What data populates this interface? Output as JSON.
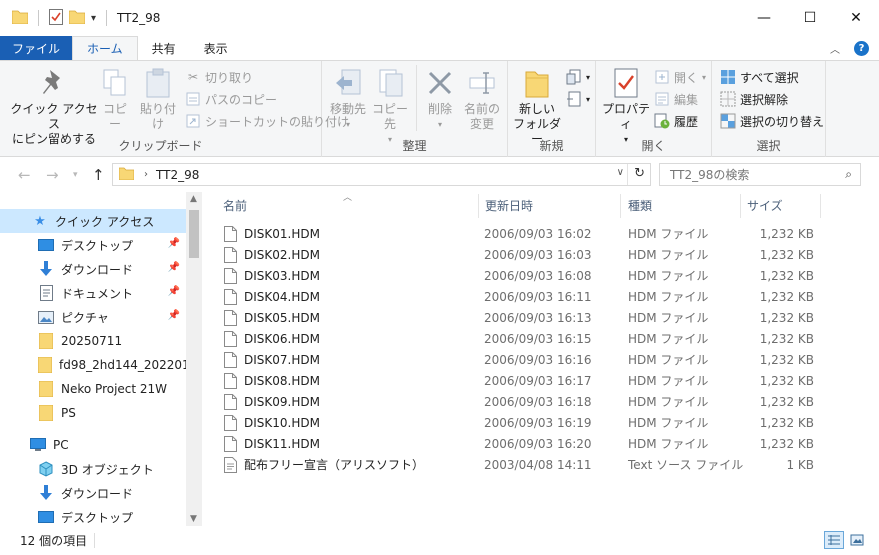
{
  "window": {
    "title": "TT2_98"
  },
  "ribbon_tabs": [
    {
      "label": "ファイル"
    },
    {
      "label": "ホーム"
    },
    {
      "label": "共有"
    },
    {
      "label": "表示"
    }
  ],
  "ribbon": {
    "clipboard": {
      "pin_label_1": "クイック アクセス",
      "pin_label_2": "にピン留めする",
      "copy": "コピー",
      "paste": "貼り付け",
      "cut": "切り取り",
      "copy_path": "パスのコピー",
      "paste_shortcut": "ショートカットの貼り付け",
      "group_label": "クリップボード"
    },
    "organize": {
      "move_to": "移動先",
      "copy_to": "コピー先",
      "delete": "削除",
      "rename_1": "名前の",
      "rename_2": "変更",
      "group_label": "整理"
    },
    "new": {
      "new_folder_1": "新しい",
      "new_folder_2": "フォルダー",
      "group_label": "新規"
    },
    "open": {
      "properties": "プロパティ",
      "open": "開く",
      "edit": "編集",
      "history": "履歴",
      "group_label": "開く"
    },
    "select": {
      "select_all": "すべて選択",
      "select_none": "選択解除",
      "invert": "選択の切り替え",
      "group_label": "選択"
    }
  },
  "address": {
    "path": "TT2_98",
    "search_placeholder": "TT2_98の検索"
  },
  "nav": {
    "quick_access": "クイック アクセス",
    "items": [
      {
        "label": "デスクトップ",
        "pinned": true
      },
      {
        "label": "ダウンロード",
        "pinned": true
      },
      {
        "label": "ドキュメント",
        "pinned": true
      },
      {
        "label": "ピクチャ",
        "pinned": true
      },
      {
        "label": "20250711",
        "pinned": false
      },
      {
        "label": "fd98_2hd144_20220123",
        "pinned": false
      },
      {
        "label": "Neko Project 21W",
        "pinned": false
      },
      {
        "label": "PS",
        "pinned": false
      }
    ],
    "pc": "PC",
    "pc_items": [
      {
        "label": "3D オブジェクト"
      },
      {
        "label": "ダウンロード"
      },
      {
        "label": "デスクトップ"
      }
    ]
  },
  "columns": {
    "name": "名前",
    "date": "更新日時",
    "type": "種類",
    "size": "サイズ"
  },
  "files": [
    {
      "name": "DISK01.HDM",
      "date": "2006/09/03 16:02",
      "type": "HDM ファイル",
      "size": "1,232 KB"
    },
    {
      "name": "DISK02.HDM",
      "date": "2006/09/03 16:03",
      "type": "HDM ファイル",
      "size": "1,232 KB"
    },
    {
      "name": "DISK03.HDM",
      "date": "2006/09/03 16:08",
      "type": "HDM ファイル",
      "size": "1,232 KB"
    },
    {
      "name": "DISK04.HDM",
      "date": "2006/09/03 16:11",
      "type": "HDM ファイル",
      "size": "1,232 KB"
    },
    {
      "name": "DISK05.HDM",
      "date": "2006/09/03 16:13",
      "type": "HDM ファイル",
      "size": "1,232 KB"
    },
    {
      "name": "DISK06.HDM",
      "date": "2006/09/03 16:15",
      "type": "HDM ファイル",
      "size": "1,232 KB"
    },
    {
      "name": "DISK07.HDM",
      "date": "2006/09/03 16:16",
      "type": "HDM ファイル",
      "size": "1,232 KB"
    },
    {
      "name": "DISK08.HDM",
      "date": "2006/09/03 16:17",
      "type": "HDM ファイル",
      "size": "1,232 KB"
    },
    {
      "name": "DISK09.HDM",
      "date": "2006/09/03 16:18",
      "type": "HDM ファイル",
      "size": "1,232 KB"
    },
    {
      "name": "DISK10.HDM",
      "date": "2006/09/03 16:19",
      "type": "HDM ファイル",
      "size": "1,232 KB"
    },
    {
      "name": "DISK11.HDM",
      "date": "2006/09/03 16:20",
      "type": "HDM ファイル",
      "size": "1,232 KB"
    },
    {
      "name": "配布フリー宣言（アリスソフト）",
      "date": "2003/04/08 14:11",
      "type": "Text ソース ファイル",
      "size": "1 KB"
    }
  ],
  "status": {
    "item_count": "12 個の項目"
  },
  "colors": {
    "accent": "#1a5fb4",
    "selection": "#cce8ff",
    "folder": "#f8d775"
  }
}
